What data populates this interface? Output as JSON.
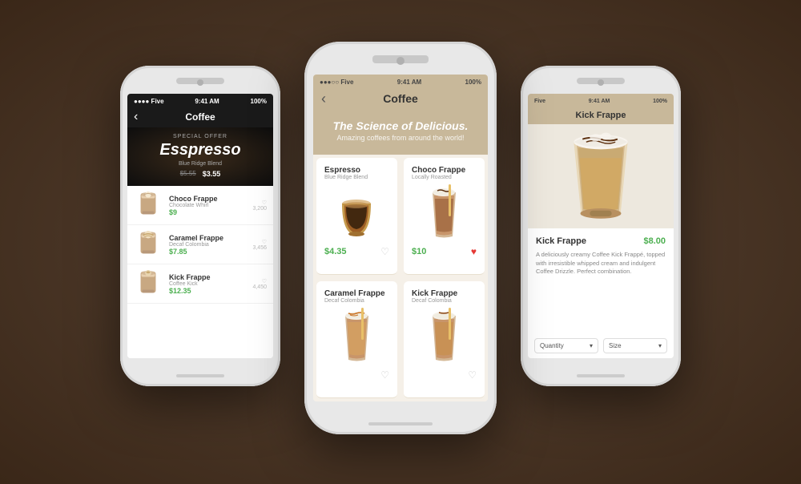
{
  "background": {
    "color": "#3a2718"
  },
  "left_phone": {
    "status": {
      "signal": "●●●● Five",
      "time": "9:41 AM",
      "battery": "100%"
    },
    "header": {
      "back": "‹",
      "title": "Coffee"
    },
    "hero": {
      "special_offer": "Special Offer",
      "product_name": "Esspresso",
      "subtitle": "Blue Ridge Blend",
      "price_old": "$5.55",
      "price_new": "$3.55"
    },
    "items": [
      {
        "name": "Choco Frappe",
        "subtitle": "Chocolate Whirl",
        "price": "$9",
        "likes": "3,200"
      },
      {
        "name": "Caramel Frappe",
        "subtitle": "Decaf Colombia",
        "price": "$7.85",
        "likes": "3,456"
      },
      {
        "name": "Kick Frappe",
        "subtitle": "Coffee Kick",
        "price": "$12.35",
        "likes": "4,450"
      }
    ]
  },
  "center_phone": {
    "status": {
      "signal": "●●●○○ Five",
      "wifi": "WiFi",
      "time": "9:41 AM",
      "battery": "100%"
    },
    "header": {
      "back": "‹",
      "title": "Coffee"
    },
    "hero": {
      "tagline": "The Science of Delicious.",
      "subtitle": "Amazing coffees from around the world!"
    },
    "products": [
      {
        "name": "Espresso",
        "subtitle": "Blue Ridge Blend",
        "price": "$4.35",
        "heart": "empty"
      },
      {
        "name": "Choco Frappe",
        "subtitle": "Locally Roasted",
        "price": "$10",
        "heart": "filled"
      },
      {
        "name": "Caramel Frappe",
        "subtitle": "Decaf Colombia",
        "price": "",
        "heart": "empty"
      },
      {
        "name": "Kick Frappe",
        "subtitle": "Decaf Colombia",
        "price": "",
        "heart": "empty"
      }
    ]
  },
  "right_phone": {
    "status": {
      "signal": "Five",
      "time": "9:41 AM",
      "battery": "100%"
    },
    "header": {
      "title": "Kick Frappe"
    },
    "product": {
      "name": "Kick Frappe",
      "price": "$8.00",
      "description": "A deliciously creamy Coffee Kick Frappé, topped with irresistible whipped cream and indulgent Coffee Drizzle. Perfect combination."
    },
    "selectors": [
      {
        "label": "Quantity",
        "icon": "▾"
      },
      {
        "label": "Size",
        "icon": "▾"
      }
    ]
  }
}
